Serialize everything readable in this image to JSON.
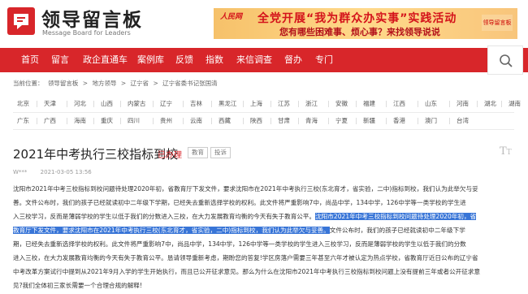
{
  "header": {
    "logo_title": "领导留言板",
    "logo_subtitle": "Message Board for Leaders",
    "banner": {
      "brand": "人民网",
      "line1": "全党开展“我为群众办实事”实践活动",
      "line2": "您有哪些困难事、烦心事？来找领导说说",
      "qr_label": "领导留言板"
    }
  },
  "nav": {
    "items": [
      "首页",
      "留言",
      "政企直通车",
      "案例库",
      "反馈",
      "指数",
      "来信调查",
      "督办",
      "专门"
    ]
  },
  "breadcrumb": {
    "prefix": "当前位置：",
    "items": [
      "领导留言板",
      "地方领导",
      "辽宁省",
      "辽宁省委书记张国清"
    ],
    "sep": ">"
  },
  "regions": {
    "row1": [
      "北京",
      "天津",
      "河北",
      "山西",
      "内蒙古",
      "辽宁",
      "吉林",
      "黑龙江",
      "上海",
      "江苏",
      "浙江",
      "安徽",
      "福建",
      "江西",
      "山东",
      "河南",
      "湖北",
      "湖南"
    ],
    "row2": [
      "广东",
      "广西",
      "海南",
      "重庆",
      "四川",
      "贵州",
      "云南",
      "西藏",
      "陕西",
      "甘肃",
      "青海",
      "宁夏",
      "新疆",
      "香港",
      "澳门",
      "台湾"
    ]
  },
  "article": {
    "title": "2021年中考执行三校指标到校",
    "status": "已办理",
    "tags": [
      "教育",
      "投诉"
    ],
    "author": "W***",
    "date": "2021-03-05 13:56",
    "lines": [
      {
        "pre": "沈阳市2021年中考三校指标到校问题待处理2020年初，省教育厅下发文件，要求沈阳市在2021年中考执行三校(东北育才，省实验，二中)指标到校，我们认为此举欠与妥",
        "hl": "",
        "post": ""
      },
      {
        "pre": "善。文件公布时，我们的孩子已经就读初中二年级下学期，已经失去重新选择学校的权利。此文件将严重影响7中，尚品中学，134中学，126中学等一类学校的学生进",
        "hl": "",
        "post": ""
      },
      {
        "pre": "入三校学习，反而是薄弱学校的学生以低于我们的分数进入三校，在大力发展教育均衡的今天有失于教育公平。",
        "hl": "沈阳市2021年中考三校指标到校问题待处理2020年初，省",
        "post": ""
      },
      {
        "pre": "",
        "hl": "教育厅下发文件，要求沈阳市在2021年中考执行三校(东北育才，省实验，二中)指标到校，我们认为此举欠与妥善。",
        "post": "文件公布时，我们的孩子已经就读初中二年级下学"
      },
      {
        "pre": "期，已经失去重新选择学校的权利。此文件将严重影响7中，尚品中学，134中学，126中学等一类学校的学生进入三校学习，反而是薄弱学校的学生以低于我们的分数",
        "hl": "",
        "post": ""
      },
      {
        "pre": "进入三校，在大力发展教育均衡的今天有失于教育公平。恳请领导重新考虑，期盼您的答复!学区房落户需要三年甚至六年才被认定为热点学校，省教育厅近日公布的辽宁省",
        "hl": "",
        "post": ""
      },
      {
        "pre": "中考改革方案试行中提到从2021年9月入学的学生开始执行，而且已公开征求意见。那么为什么在沈阳市2021年中考执行三校指标到校问题上没有提前三年或者公开征求意",
        "hl": "",
        "post": ""
      },
      {
        "pre": "见?我们全体初三家长需要一个合理合规的解释!",
        "hl": "",
        "post": ""
      }
    ]
  },
  "colors": {
    "brand_red": "#d8262a",
    "highlight": "#3875d7"
  }
}
